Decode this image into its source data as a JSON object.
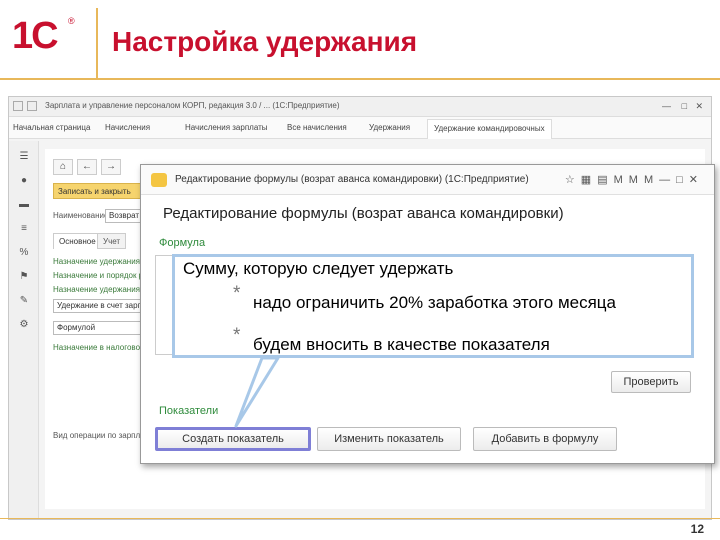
{
  "slide": {
    "logo_text": "1С",
    "logo_mark": "®",
    "title": "Настройка удержания",
    "page_number": "12"
  },
  "app": {
    "window_title": "Зарплата и управление персоналом КОРП, редакция 3.0 / ... (1С:Предприятие)",
    "tabs": [
      "Начальная страница",
      "Начисления",
      "Начисления зарплаты",
      "Все начисления",
      "Удержания",
      "Удержание командировочных"
    ],
    "save_button": "Записать и закрыть",
    "fields": {
      "name_label": "Наименование:",
      "name_value": "Возврат аванса",
      "subtab_main": "Основное",
      "subtab_other": "Учет",
      "link1": "Назначение удержания",
      "link2": "Назначение и порядок расчета",
      "link3": "Назначение удержания",
      "select1": "Удержание в счет зарплаты",
      "select2": "Формулой",
      "link4": "Назначение в налоговом учете",
      "bottom_label": "Вид операции по зарплате:"
    }
  },
  "dialog": {
    "bar_title": "Редактирование формулы (возрат аванса командировки) (1С:Предприятие)",
    "heading": "Редактирование формулы (возрат аванса командировки)",
    "formula_label": "Формула",
    "check_button": "Проверить",
    "indicators_label": "Показатели",
    "buttons": {
      "create": "Создать показатель",
      "edit": "Изменить показатель",
      "add": "Добавить в формулу"
    }
  },
  "callout": {
    "title": "Сумму, которую следует удержать",
    "items": [
      "надо ограничить 20% заработка этого месяца",
      "будем вносить в качестве показателя"
    ],
    "bullet_glyph": "*"
  },
  "colors": {
    "brand_red": "#c8102e",
    "accent_gold": "#e8b85a",
    "label_green": "#2f8b3c",
    "callout_border": "#a8c8e8",
    "highlight_border": "#7f7fd6"
  }
}
